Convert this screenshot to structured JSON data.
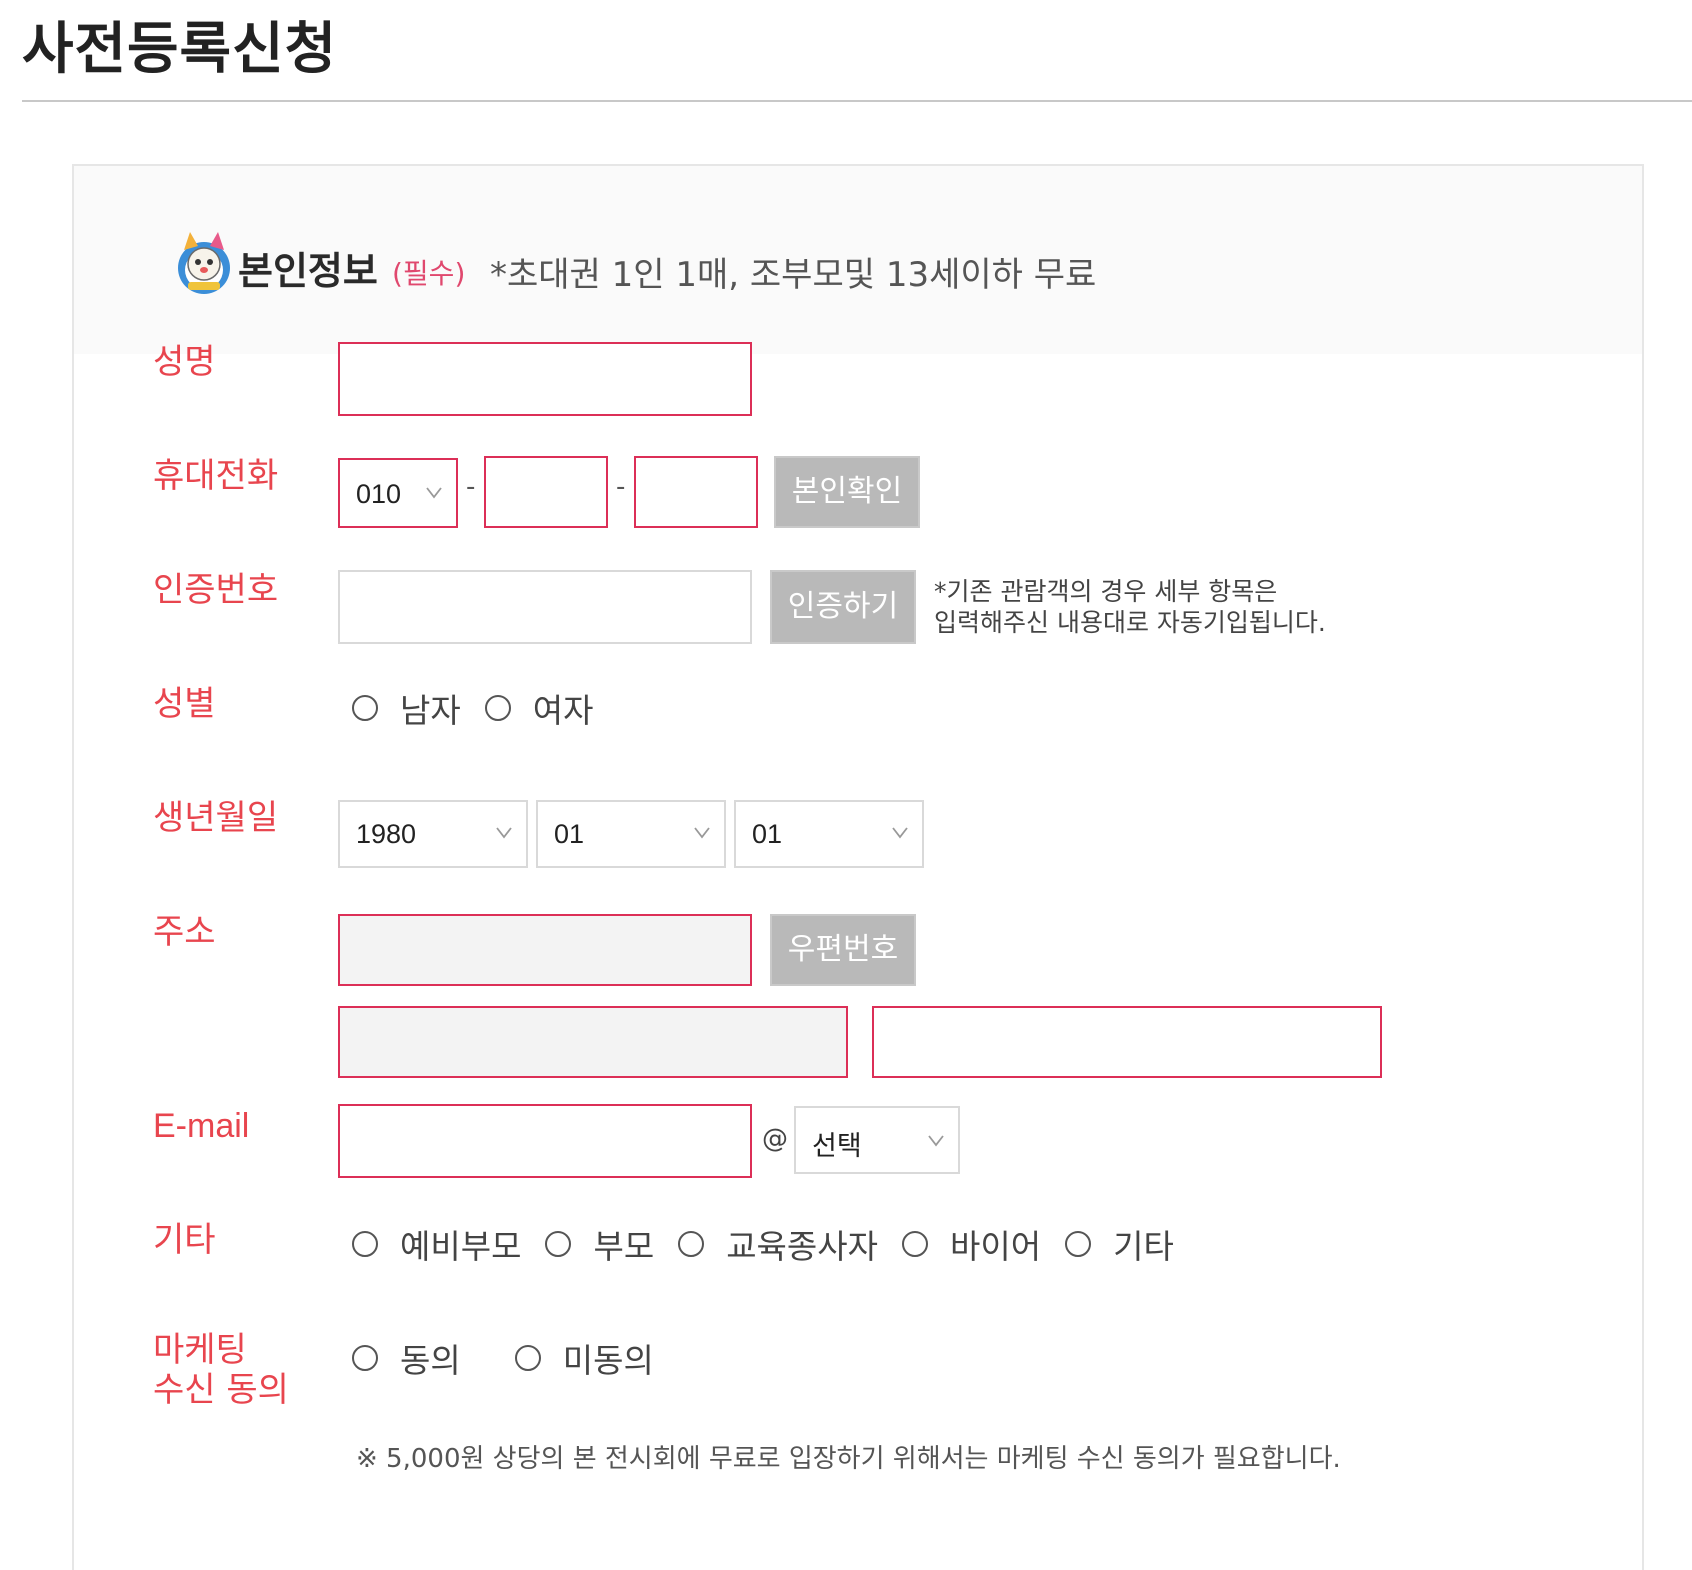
{
  "page": {
    "title": "사전등록신청"
  },
  "section": {
    "title": "본인정보",
    "required_tag": "(필수)",
    "note": "*초대권 1인 1매, 조부모및 13세이하 무료"
  },
  "fields": {
    "name": {
      "label": "성명",
      "value": ""
    },
    "phone": {
      "label": "휴대전화",
      "prefix": "010",
      "sep1": "-",
      "sep2": "-",
      "middle": "",
      "last": "",
      "verify_button": "본인확인"
    },
    "auth": {
      "label": "인증번호",
      "value": "",
      "button": "인증하기",
      "note_line1": "*기존 관람객의 경우 세부 항목은",
      "note_line2": "입력해주신 내용대로 자동기입됩니다."
    },
    "gender": {
      "label": "성별",
      "options": [
        "남자",
        "여자"
      ]
    },
    "birth": {
      "label": "생년월일",
      "year": "1980",
      "month": "01",
      "day": "01"
    },
    "address": {
      "label": "주소",
      "zip_button": "우편번호"
    },
    "email": {
      "label": "E-mail",
      "at": "@",
      "domain_select": "선택"
    },
    "other": {
      "label": "기타",
      "options": [
        "예비부모",
        "부모",
        "교육종사자",
        "바이어",
        "기타"
      ]
    },
    "marketing": {
      "label_line1": "마케팅",
      "label_line2": "수신 동의",
      "options": [
        "동의",
        "미동의"
      ],
      "note": "※ 5,000원 상당의 본 전시회에 무료로 입장하기 위해서는 마케팅 수신 동의가 필요합니다."
    }
  },
  "colors": {
    "label_red": "#e8454e",
    "field_border_red": "#dc2f57",
    "button_gray": "#b9b9b9",
    "required_pink": "#e0486e"
  },
  "icons": {
    "mascot": "mascot-icon",
    "chevron": "chevron-down-icon",
    "radio": "radio-icon"
  }
}
